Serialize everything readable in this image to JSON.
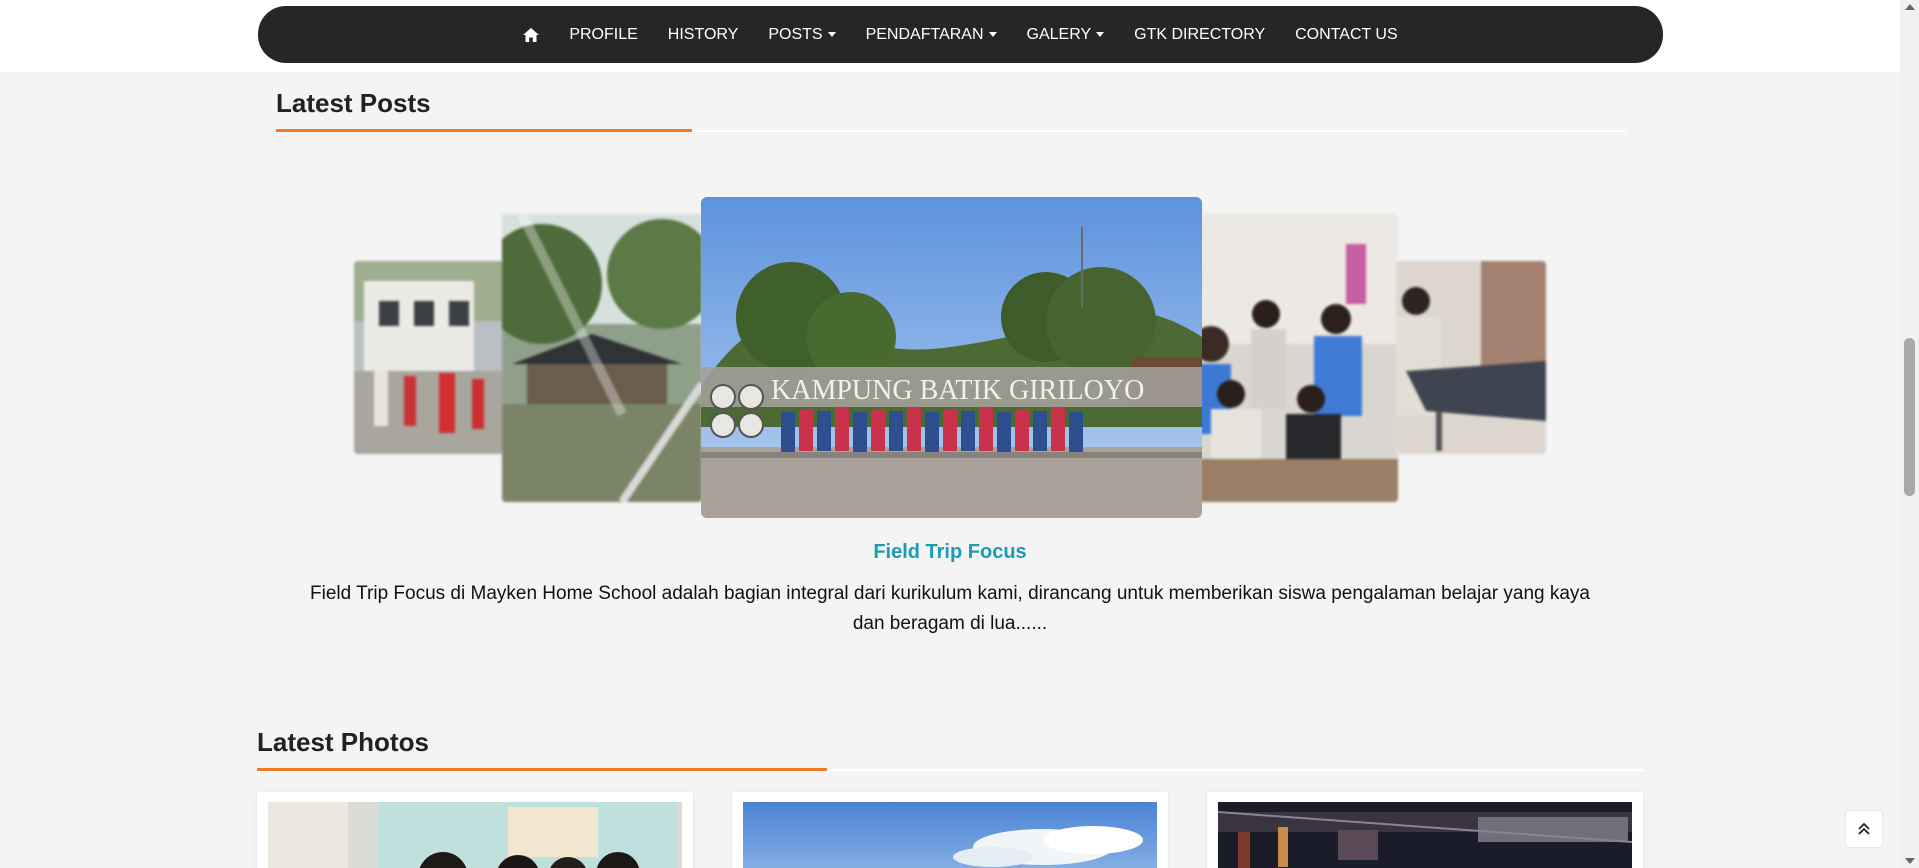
{
  "nav": {
    "home_icon": "home-icon",
    "items": [
      {
        "label": "PROFILE",
        "dropdown": false
      },
      {
        "label": "HISTORY",
        "dropdown": false
      },
      {
        "label": "POSTS",
        "dropdown": true
      },
      {
        "label": "PENDAFTARAN",
        "dropdown": true
      },
      {
        "label": "GALERY",
        "dropdown": true
      },
      {
        "label": "GTK DIRECTORY",
        "dropdown": false
      },
      {
        "label": "CONTACT US",
        "dropdown": false
      }
    ]
  },
  "latest_posts": {
    "heading": "Latest Posts",
    "active_post": {
      "sign_text": "KAMPUNG BATIK GIRILOYO",
      "title": "Field Trip Focus",
      "excerpt": "Field Trip Focus di Mayken Home School adalah bagian integral dari kurikulum kami, dirancang untuk memberikan siswa pengalaman belajar yang kaya dan beragam di lua......"
    }
  },
  "latest_photos": {
    "heading": "Latest Photos"
  },
  "colors": {
    "navbar": "#262626",
    "accent": "#ef7a26",
    "post_title": "#1c9cb4",
    "background": "#f4f4f4"
  },
  "back_to_top_icon": "double-chevron-up-icon"
}
